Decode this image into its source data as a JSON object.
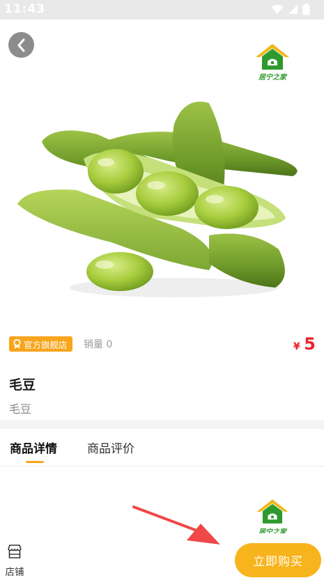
{
  "status_bar": {
    "time": "11:43",
    "icons": [
      "wifi-icon",
      "signal-icon",
      "battery-icon"
    ]
  },
  "header": {
    "back_icon": "chevron-left-icon",
    "brand_logo_text": "居宁之家"
  },
  "product": {
    "badge_label": "官方旗舰店",
    "badge_icon": "award-icon",
    "sales_text": "销量 0",
    "price_currency": "¥",
    "price_value": "5",
    "name": "毛豆",
    "subtitle": "毛豆"
  },
  "tabs": [
    {
      "label": "商品详情",
      "active": true
    },
    {
      "label": "商品评价",
      "active": false
    }
  ],
  "detail_logo_text": "居宁之家",
  "bottom_bar": {
    "store_label": "店铺",
    "store_icon": "store-icon",
    "buy_label": "立即购买"
  },
  "colors": {
    "accent": "#f7a51c",
    "buy_button": "#f8b41c",
    "price": "#e8262c",
    "logo_green": "#2e9a2e",
    "arrow": "#f04848"
  }
}
